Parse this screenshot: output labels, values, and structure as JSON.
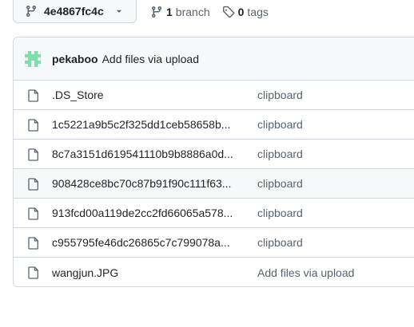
{
  "branch_selector": {
    "current_ref": "4e4867fc4c",
    "icon": "git-branch-icon"
  },
  "branches": {
    "count": "1",
    "label": "branch",
    "icon": "git-branch-icon"
  },
  "tags": {
    "count": "0",
    "label": "tags",
    "icon": "tag-icon"
  },
  "latest_commit": {
    "author": "pekaboo",
    "message": "Add files via upload",
    "avatar_color": "#7ee0a8"
  },
  "files": [
    {
      "name": ".DS_Store",
      "commit_message": "clipboard"
    },
    {
      "name": "1c5221a9b5c2f325dd1ceb58658b...",
      "commit_message": "clipboard"
    },
    {
      "name": "8c7a3151d619541110b9b8886a0d...",
      "commit_message": "clipboard"
    },
    {
      "name": "908428ce8bc70c87b91f90c111f63...",
      "commit_message": "clipboard"
    },
    {
      "name": "913fcd00a119de2cc2fd66065a578...",
      "commit_message": "clipboard"
    },
    {
      "name": "c955795fe46dc26865c7c799078a...",
      "commit_message": "clipboard"
    },
    {
      "name": "wangjun.JPG",
      "commit_message": "Add files via upload"
    }
  ],
  "colors": {
    "border": "#d0d7de",
    "header_bg": "#f6f8fa",
    "muted_text": "#59636e",
    "text": "#1f2328"
  }
}
